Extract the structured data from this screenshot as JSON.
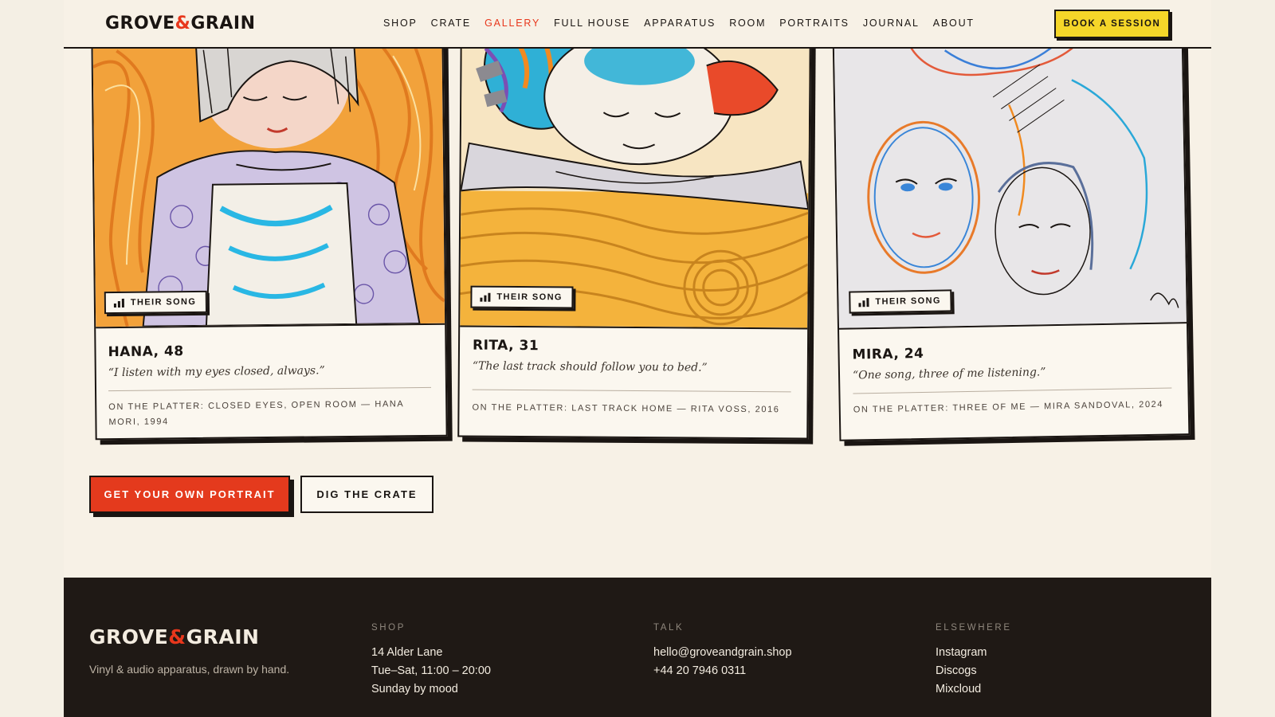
{
  "header": {
    "logo": {
      "part1": "GROVE",
      "amp": "&",
      "part2": "GRAIN"
    },
    "nav": [
      {
        "label": "SHOP",
        "active": false
      },
      {
        "label": "CRATE",
        "active": false
      },
      {
        "label": "GALLERY",
        "active": true
      },
      {
        "label": "FULL HOUSE",
        "active": false
      },
      {
        "label": "APPARATUS",
        "active": false
      },
      {
        "label": "ROOM",
        "active": false
      },
      {
        "label": "PORTRAITS",
        "active": false
      },
      {
        "label": "JOURNAL",
        "active": false
      },
      {
        "label": "ABOUT",
        "active": false
      }
    ],
    "book_label": "BOOK A SESSION"
  },
  "cards": [
    {
      "badge": "THEIR SONG",
      "name": "HANA, 48",
      "quote": "“I listen with my eyes closed, always.”",
      "platter": "ON THE PLATTER: CLOSED EYES, OPEN ROOM — HANA MORI, 1994"
    },
    {
      "badge": "THEIR SONG",
      "name": "RITA, 31",
      "quote": "“The last track should follow you to bed.”",
      "platter": "ON THE PLATTER: LAST TRACK HOME — RITA VOSS, 2016"
    },
    {
      "badge": "THEIR SONG",
      "name": "MIRA, 24",
      "quote": "“One song, three of me listening.”",
      "platter": "ON THE PLATTER: THREE OF ME — MIRA SANDOVAL, 2024"
    }
  ],
  "cta": {
    "primary": "GET YOUR OWN PORTRAIT",
    "secondary": "DIG THE CRATE"
  },
  "footer": {
    "logo": {
      "part1": "GROVE",
      "amp": "&",
      "part2": "GRAIN"
    },
    "tagline": "Vinyl & audio apparatus, drawn by hand.",
    "shop": {
      "heading": "SHOP",
      "lines": [
        "14 Alder Lane",
        "Tue–Sat, 11:00 – 20:00",
        "Sunday by mood"
      ]
    },
    "talk": {
      "heading": "TALK",
      "lines": [
        "hello@groveandgrain.shop",
        "+44 20 7946 0311"
      ]
    },
    "elsewhere": {
      "heading": "ELSEWHERE",
      "lines": [
        "Instagram",
        "Discogs",
        "Mixcloud"
      ]
    }
  },
  "colors": {
    "accent": "#e8371c",
    "highlight": "#f5d629",
    "ink": "#1a1512",
    "paper": "#f7f1e6",
    "footer_bg": "#1f1915"
  }
}
